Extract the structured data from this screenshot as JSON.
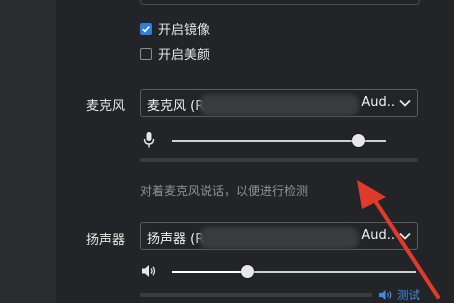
{
  "camera": {
    "mirror_label": "开启镜像",
    "mirror_checked": true,
    "beauty_label": "开启美颜",
    "beauty_checked": false
  },
  "microphone": {
    "label": "麦克风",
    "device_name": "麦克风 (R",
    "device_suffix": "Aud..",
    "volume": 0.87,
    "hint": "对着麦克风说话，以便进行检测"
  },
  "speaker": {
    "label": "扬声器",
    "device_name": "扬声器 (R",
    "device_suffix": "Aud..",
    "volume": 0.31,
    "test_label": "测试"
  },
  "colors": {
    "accent": "#2f7ed8",
    "link": "#3b8de0",
    "annotation_arrow": "#e03a2b"
  }
}
